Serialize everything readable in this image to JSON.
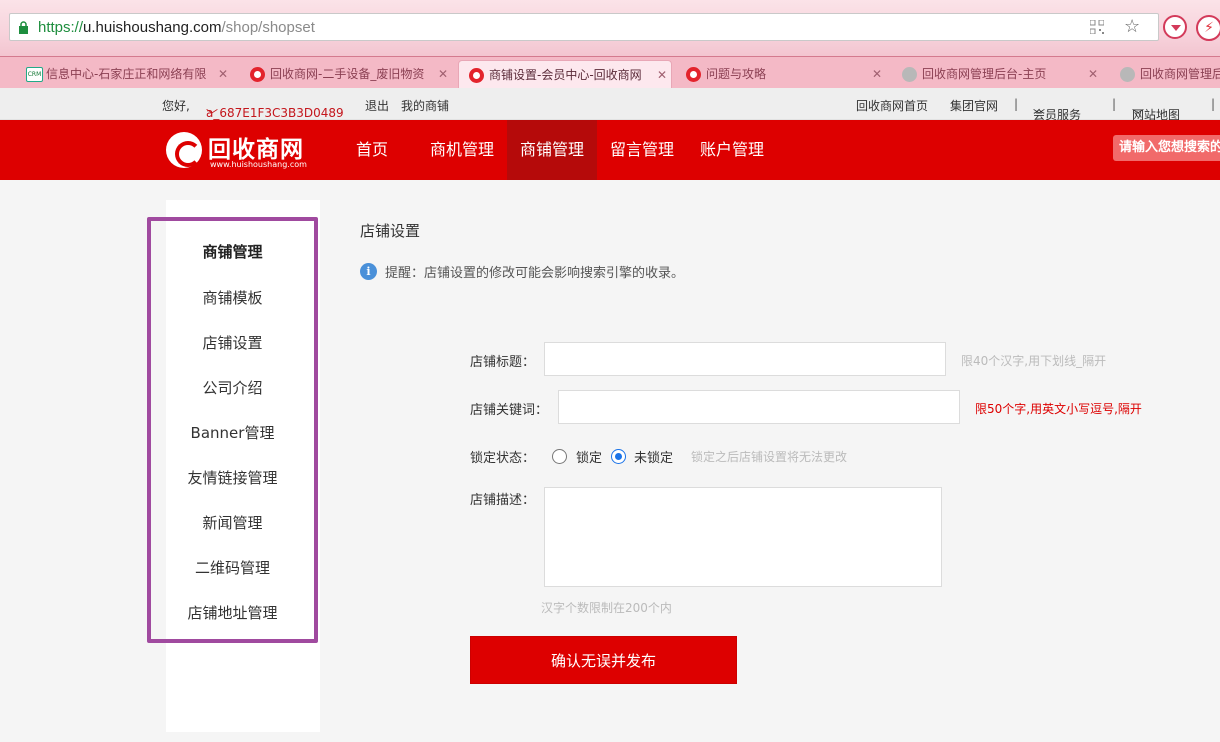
{
  "browser": {
    "url_scheme": "https://",
    "url_host": "u.huishoushang.com",
    "url_path": "/shop/shopset",
    "tabs": [
      {
        "label": "信息中心-石家庄正和网络有限",
        "favicon": "crm-icon"
      },
      {
        "label": "回收商网-二手设备_废旧物资",
        "favicon": "site-logo-icon"
      },
      {
        "label": "商铺设置-会员中心-回收商网",
        "favicon": "site-logo-icon",
        "active": true
      },
      {
        "label": "问题与攻略",
        "favicon": "site-logo-icon"
      },
      {
        "label": "回收商网管理后台-主页",
        "favicon": "globe-icon"
      },
      {
        "label": "回收商网管理后台",
        "favicon": "globe-icon"
      }
    ]
  },
  "topstrip": {
    "greeting": "您好,",
    "username": "a_687E1F3C3B3D0489",
    "logout": "退出",
    "my_shop": "我的商铺",
    "home": "回收商网首页",
    "group_site": "集团官网",
    "sep": "|",
    "member_service": "会员服务",
    "site_map": "网站地图"
  },
  "header": {
    "logo_text": "回收商网",
    "logo_sub": "www.huishoushang.com",
    "nav": [
      "首页",
      "商机管理",
      "商铺管理",
      "留言管理",
      "账户管理"
    ],
    "active_nav": "商铺管理",
    "search_placeholder": "请输入您想搜索的"
  },
  "sidebar": {
    "title": "商铺管理",
    "items": [
      "商铺模板",
      "店铺设置",
      "公司介绍",
      "Banner管理",
      "友情链接管理",
      "新闻管理",
      "二维码管理",
      "店铺地址管理"
    ]
  },
  "main": {
    "title": "店铺设置",
    "tip": "提醒：店铺设置的修改可能会影响搜索引擎的收录。",
    "fields": {
      "shop_title_label": "店铺标题：",
      "shop_title_value": "",
      "shop_title_hint": "限40个汉字,用下划线_隔开",
      "keywords_label": "店铺关键词：",
      "keywords_value": "",
      "keywords_hint": "限50个字,用英文小写逗号,隔开",
      "lock_label": "锁定状态：",
      "lock_option_locked": "锁定",
      "lock_option_unlocked": "未锁定",
      "lock_selected": "未锁定",
      "lock_hint": "锁定之后店铺设置将无法更改",
      "desc_label": "店铺描述：",
      "desc_value": "",
      "desc_hint": "汉字个数限制在200个内"
    },
    "submit_label": "确认无误并发布"
  },
  "colors": {
    "brand_red": "#dd0000",
    "sidebar_highlight": "#a04a9f",
    "radio_blue": "#1a73e8"
  }
}
